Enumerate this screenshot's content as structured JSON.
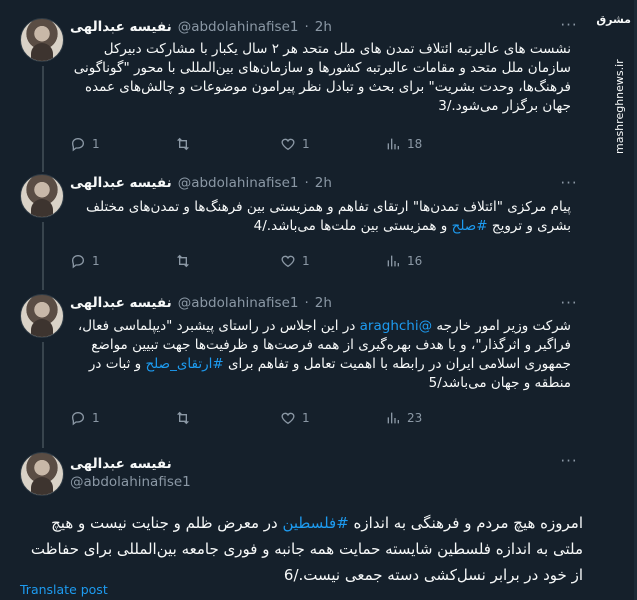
{
  "watermark": {
    "logo_text": "مشرق",
    "url": "mashreghnews.ir"
  },
  "author": {
    "name": "نفیسه عبدالهی",
    "handle": "@abdolahinafise1"
  },
  "tweets": [
    {
      "time": "2h",
      "text_parts": [
        {
          "t": "نشست های عالیرتبه ائتلاف تمدن های ملل متحد هر ۲ سال یکبار با مشارکت دبیرکل سازمان ملل متحد و مقامات عالیرتبه کشورها و سازمان‌های بین‌المللی با محور \"گوناگونی فرهنگ‌ها، وحدت بشریت\" برای بحث و تبادل نظر پیرامون موضوعات و چالش‌های عمده جهان برگزار می‌شود./3",
          "link": false
        }
      ],
      "replies": "1",
      "retweets": "",
      "likes": "1",
      "views": "18"
    },
    {
      "time": "2h",
      "text_parts": [
        {
          "t": "پیام مرکزی \"ائتلاف تمدن‌ها\" ارتقای تفاهم و همزیستی بین فرهنگ‌ها و تمدن‌های مختلف بشری و ترویج ",
          "link": false
        },
        {
          "t": "#صلح",
          "link": true
        },
        {
          "t": " و همزیستی بین ملت‌ها می‌باشد./4",
          "link": false
        }
      ],
      "replies": "1",
      "retweets": "",
      "likes": "1",
      "views": "16"
    },
    {
      "time": "2h",
      "text_parts": [
        {
          "t": "شرکت وزیر امور خارجه ",
          "link": false
        },
        {
          "t": "@araghchi",
          "link": true
        },
        {
          "t": " در این اجلاس در راستای پیشبرد \"دیپلماسی فعال، فراگیر و اثرگذار\"، و با هدف بهره‌گیری از همه فرصت‌ها و ظرفیت‌ها جهت تبیین مواضع جمهوری اسلامی ایران در رابطه با اهمیت تعامل و تفاهم برای ",
          "link": false
        },
        {
          "t": "#ارتقای_صلح",
          "link": true
        },
        {
          "t": " و ثبات در منطقه و جهان می‌باشد/5",
          "link": false
        }
      ],
      "replies": "1",
      "retweets": "",
      "likes": "1",
      "views": "23"
    }
  ],
  "last_tweet": {
    "text_parts": [
      {
        "t": "امروزه هیچ مردم و فرهنگی به اندازه ",
        "link": false
      },
      {
        "t": "#فلسطین",
        "link": true
      },
      {
        "t": " در معرض ظلم و جنایت نیست و هیچ ملتی به اندازه فلسطین شایسته حمایت همه جانبه و فوری جامعه بین‌المللی برای حفاظت از خود در برابر نسل‌کشی دسته جمعی نیست./6",
        "link": false
      }
    ],
    "translate_label": "Translate post"
  },
  "more_icon": "more-dots-icon",
  "sep": "·"
}
